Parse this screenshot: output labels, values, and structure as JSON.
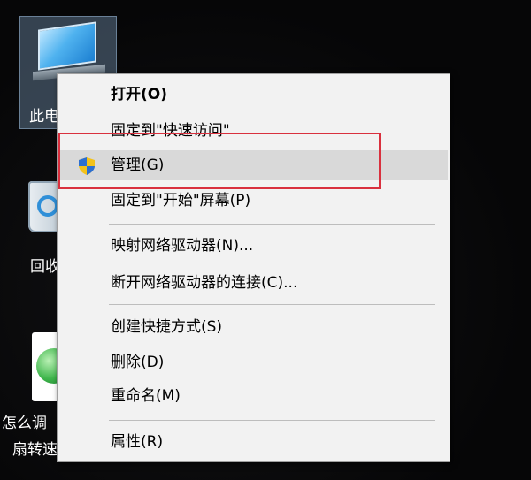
{
  "desktop": {
    "icons": [
      {
        "label": "此电"
      },
      {
        "label": "回收"
      },
      {
        "label_line1": "怎么调",
        "label_line2": "扇转速"
      }
    ]
  },
  "context_menu": {
    "items": [
      {
        "label": "打开(O)",
        "bold": true
      },
      {
        "label": "固定到\"快速访问\""
      },
      {
        "label": "管理(G)",
        "icon": "uac-shield-icon",
        "highlighted": true
      },
      {
        "label": "固定到\"开始\"屏幕(P)"
      },
      {
        "label": "映射网络驱动器(N)..."
      },
      {
        "label": "断开网络驱动器的连接(C)..."
      },
      {
        "label": "创建快捷方式(S)"
      },
      {
        "label": "删除(D)"
      },
      {
        "label": "重命名(M)"
      },
      {
        "label": "属性(R)"
      }
    ]
  },
  "colors": {
    "annotation": "#d9303e",
    "menu_bg": "#f2f2f2",
    "highlight_bg": "#d9d9d9"
  }
}
